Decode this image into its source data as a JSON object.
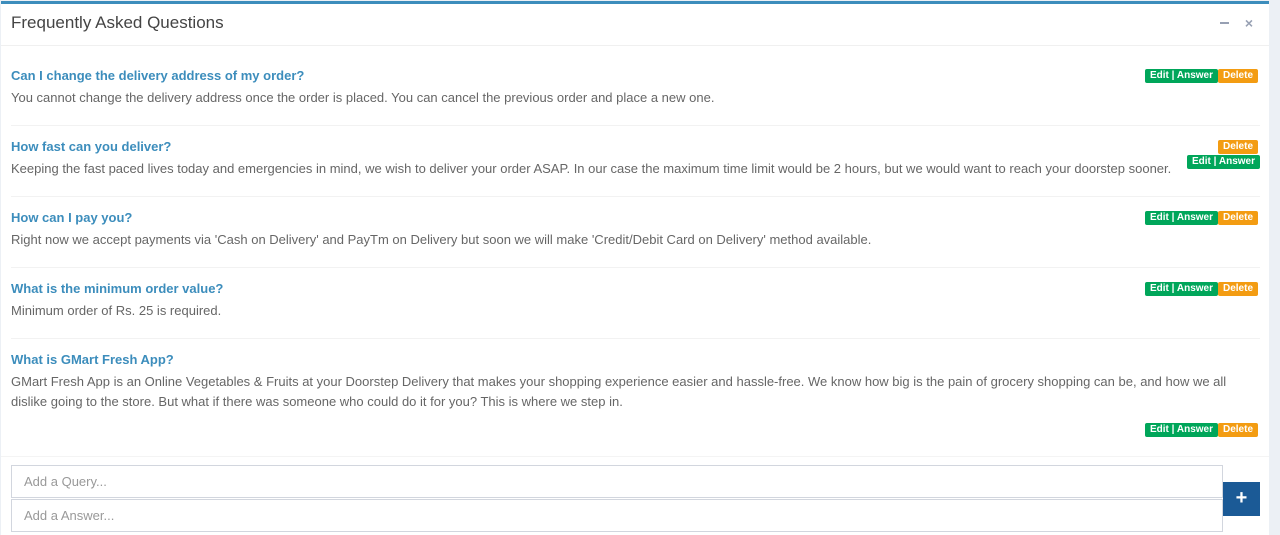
{
  "header": {
    "title": "Frequently Asked Questions",
    "minimize_icon": "minus-icon",
    "close_icon": "times-icon"
  },
  "buttons": {
    "edit_label": "Edit | Answer",
    "delete_label": "Delete"
  },
  "faqs": [
    {
      "question": "Can I change the delivery address of my order?",
      "answer": "You cannot change the delivery address once the order is placed. You can cancel the previous order and place a new one."
    },
    {
      "question": "How fast can you deliver?",
      "answer": "Keeping the fast paced lives today and emergencies in mind, we wish to deliver your order ASAP. In our case the maximum time limit would be 2 hours, but we would want to reach your doorstep sooner."
    },
    {
      "question": "How can I pay you?",
      "answer": "Right now we accept payments via 'Cash on Delivery' and PayTm on Delivery but soon we will make 'Credit/Debit Card on Delivery' method available."
    },
    {
      "question": "What is the minimum order value?",
      "answer": "Minimum order of Rs. 25 is required."
    },
    {
      "question": "What is GMart Fresh App?",
      "answer": "GMart Fresh App is an Online Vegetables & Fruits at your Doorstep Delivery that makes your shopping experience easier and hassle-free. We know how big is the pain of grocery shopping can be, and how we all dislike going to the store. But what if there was someone who could do it for you? This is where we step in."
    }
  ],
  "form": {
    "query_placeholder": "Add a Query...",
    "answer_placeholder": "Add a Answer...",
    "add_button_label": "+"
  },
  "colors": {
    "accent": "#3c8dbc",
    "edit": "#00a65a",
    "delete": "#f39c12",
    "add_button": "#1b5a96"
  }
}
